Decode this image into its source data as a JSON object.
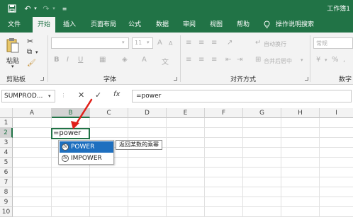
{
  "titlebar": {
    "title": "工作簿1"
  },
  "tabs": [
    "文件",
    "开始",
    "插入",
    "页面布局",
    "公式",
    "数据",
    "审阅",
    "视图",
    "帮助",
    "操作说明搜索"
  ],
  "ribbon": {
    "paste_label": "粘贴",
    "clipboard_label": "剪贴板",
    "font_label": "字体",
    "align_label": "对齐方式",
    "number_label": "数字",
    "font_size": "11",
    "font_grow": "A",
    "font_shrink": "A",
    "wrap_text": "自动换行",
    "merge_center": "合并后居中",
    "number_format": "常规",
    "percent": "%",
    "comma": ","
  },
  "formula_bar": {
    "name_box": "SUMPROD...",
    "cancel": "✕",
    "enter": "✓",
    "fx": "fx",
    "formula": "=power"
  },
  "grid": {
    "columns": [
      "A",
      "B",
      "C",
      "D",
      "E",
      "F",
      "G",
      "H",
      "I"
    ],
    "rows": [
      "1",
      "2",
      "3",
      "4",
      "5",
      "6",
      "7",
      "8",
      "9",
      "10"
    ],
    "active_cell_text": "=power"
  },
  "autocomplete": {
    "items": [
      "POWER",
      "IMPOWER"
    ],
    "tooltip": "返回某数的乘幂"
  },
  "colors": {
    "accent": "#217346",
    "selection": "#1e6fbf",
    "arrow": "#e0201a"
  }
}
